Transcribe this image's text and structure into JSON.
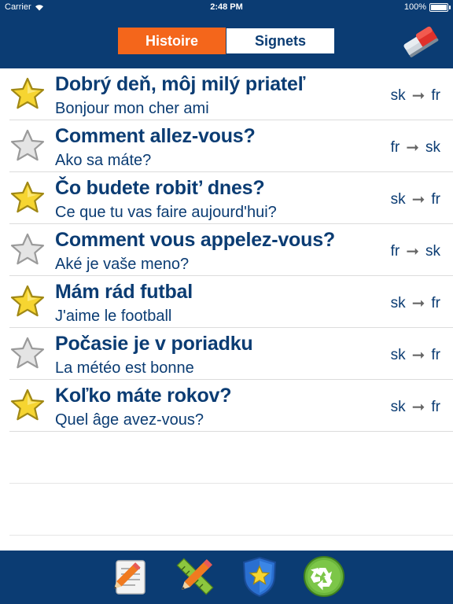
{
  "status": {
    "carrier": "Carrier",
    "time": "2:48 PM",
    "battery": "100%"
  },
  "tabs": [
    {
      "label": "Histoire",
      "active": true
    },
    {
      "label": "Signets",
      "active": false
    }
  ],
  "items": [
    {
      "title": "Dobrý deň, môj milý priateľ",
      "subtitle": "Bonjour mon cher ami",
      "from": "sk",
      "to": "fr",
      "starred": true
    },
    {
      "title": "Comment allez-vous?",
      "subtitle": "Ako sa máte?",
      "from": "fr",
      "to": "sk",
      "starred": false
    },
    {
      "title": "Čo budete robit’ dnes?",
      "subtitle": "Ce que tu vas faire aujourd'hui?",
      "from": "sk",
      "to": "fr",
      "starred": true
    },
    {
      "title": "Comment vous appelez-vous?",
      "subtitle": "Aké je vaše meno?",
      "from": "fr",
      "to": "sk",
      "starred": false
    },
    {
      "title": "Mám rád futbal",
      "subtitle": "J'aime le football",
      "from": "sk",
      "to": "fr",
      "starred": true
    },
    {
      "title": "Počasie je v poriadku",
      "subtitle": "La météo est bonne",
      "from": "sk",
      "to": "fr",
      "starred": false
    },
    {
      "title": "Koľko máte rokov?",
      "subtitle": "Quel âge avez-vous?",
      "from": "sk",
      "to": "fr",
      "starred": true
    }
  ],
  "arrow": "➞",
  "colors": {
    "header": "#0b3c73",
    "accent": "#f4661b",
    "star_gold": "#f6d531",
    "star_gray": "#d6d6d6"
  },
  "toolbar_icons": [
    "notepad-pencil-icon",
    "ruler-pencil-icon",
    "star-shield-icon",
    "recycle-icon"
  ]
}
